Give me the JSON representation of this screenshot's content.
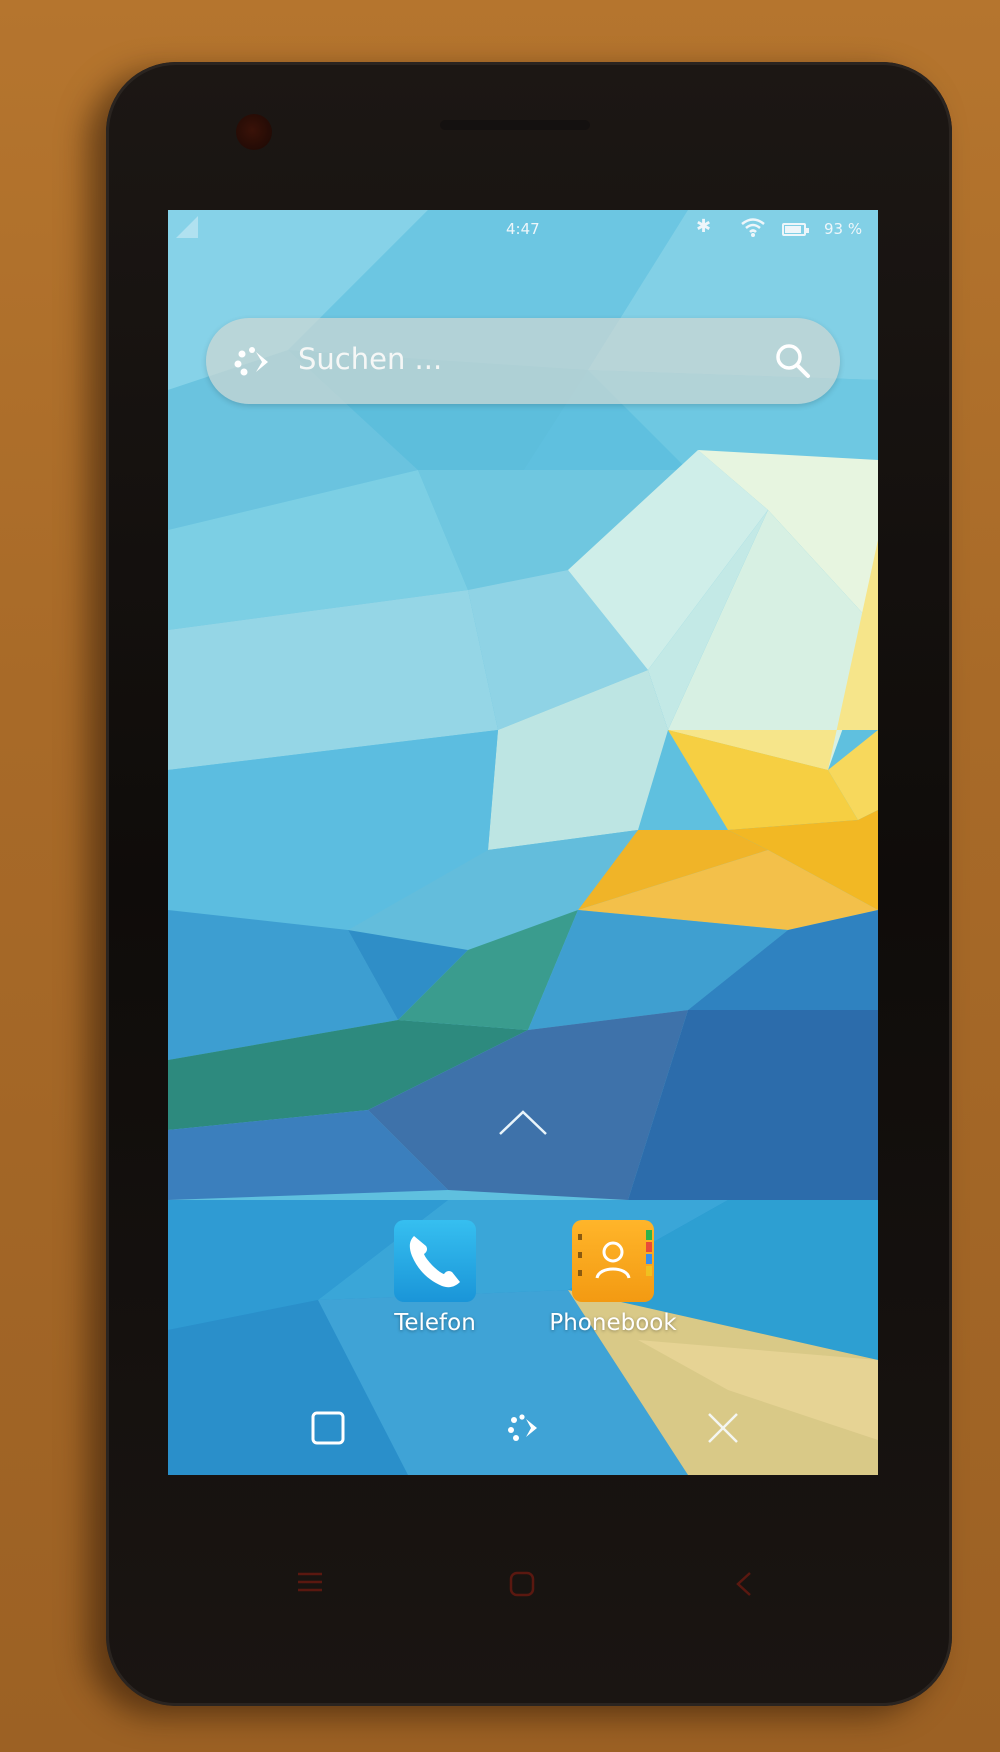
{
  "status_bar": {
    "time": "4:47",
    "battery_percent": "93 %",
    "icons": [
      "signal-icon",
      "bluetooth-icon",
      "wifi-icon",
      "battery-icon"
    ]
  },
  "search": {
    "placeholder": "Suchen ...",
    "logo_icon": "plasma-launcher-icon",
    "action_icon": "search-icon"
  },
  "drawer": {
    "icon": "chevron-up-icon"
  },
  "favorites": [
    {
      "label": "Telefon",
      "icon": "phone-icon",
      "color": "#1fa8e3"
    },
    {
      "label": "Phonebook",
      "icon": "contacts-book-icon",
      "color": "#f7a51c"
    }
  ],
  "navigation": {
    "buttons": [
      "window-switcher-icon",
      "launcher-icon",
      "close-icon"
    ]
  },
  "hardware_keys": [
    "menu-key-icon",
    "home-key-icon",
    "back-key-icon"
  ],
  "colors": {
    "wallpaper_sky": "#6ec9e3",
    "wallpaper_yellow": "#f6c232",
    "wallpaper_deep": "#1a78b8",
    "search_bar": "#c9d6d2",
    "phone_body": "#15110e"
  }
}
